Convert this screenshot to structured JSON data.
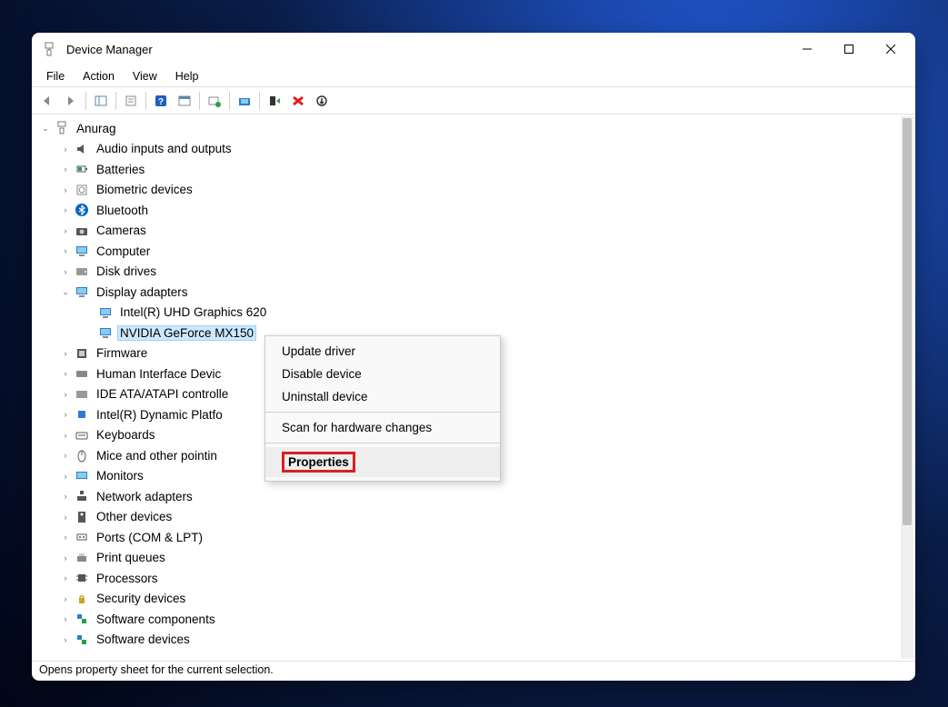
{
  "window": {
    "title": "Device Manager"
  },
  "menu": {
    "file": "File",
    "action": "Action",
    "view": "View",
    "help": "Help"
  },
  "tree": {
    "root": "Anurag",
    "items": [
      "Audio inputs and outputs",
      "Batteries",
      "Biometric devices",
      "Bluetooth",
      "Cameras",
      "Computer",
      "Disk drives",
      "Display adapters",
      "Firmware",
      "Human Interface Devic",
      "IDE ATA/ATAPI controlle",
      "Intel(R) Dynamic Platfo",
      "Keyboards",
      "Mice and other pointin",
      "Monitors",
      "Network adapters",
      "Other devices",
      "Ports (COM & LPT)",
      "Print queues",
      "Processors",
      "Security devices",
      "Software components",
      "Software devices"
    ],
    "display_children": [
      "Intel(R) UHD Graphics 620",
      "NVIDIA GeForce MX150"
    ]
  },
  "context_menu": {
    "update": "Update driver",
    "disable": "Disable device",
    "uninstall": "Uninstall device",
    "scan": "Scan for hardware changes",
    "properties": "Properties"
  },
  "status": "Opens property sheet for the current selection."
}
